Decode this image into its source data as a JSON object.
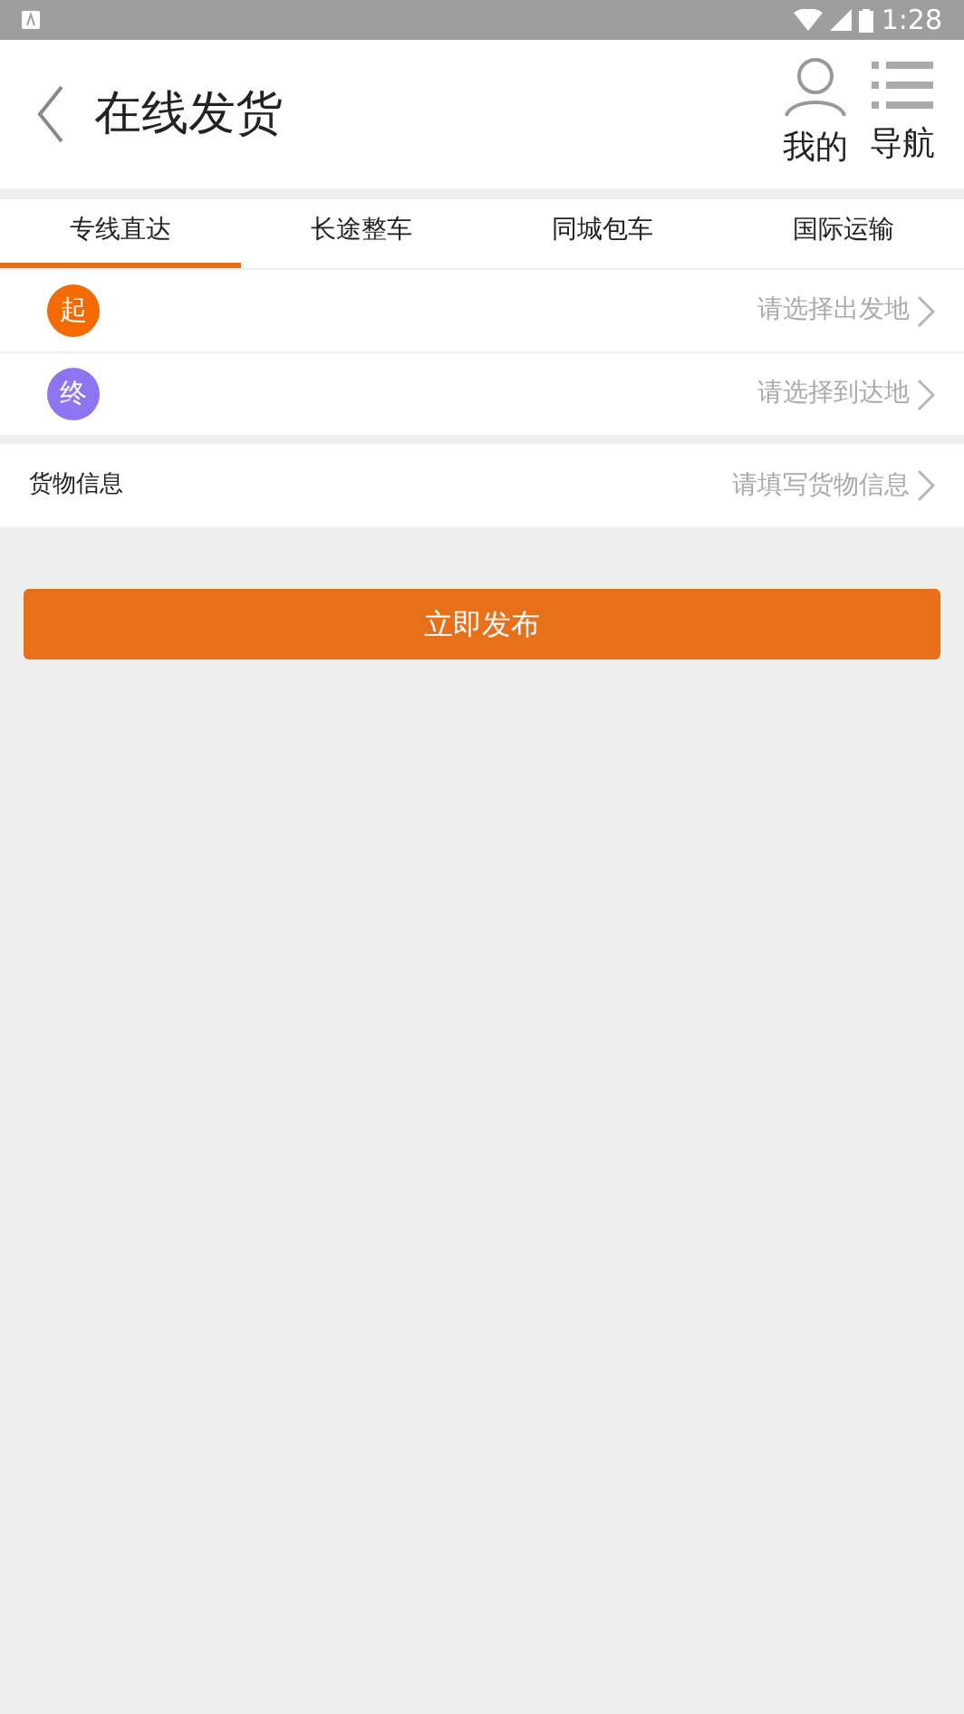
{
  "status_bar": {
    "time": "1:28"
  },
  "header": {
    "title": "在线发货",
    "actions": [
      {
        "kind": "person",
        "label": "我的"
      },
      {
        "kind": "list",
        "label": "导航"
      }
    ]
  },
  "tabs": [
    {
      "label": "专线直达",
      "selected": true
    },
    {
      "label": "长途整车",
      "selected": false
    },
    {
      "label": "同城包车",
      "selected": false
    },
    {
      "label": "国际运输",
      "selected": false
    }
  ],
  "route": [
    {
      "badge": "起",
      "color": "#f56a00",
      "placeholder": "请选择出发地"
    },
    {
      "badge": "终",
      "color": "#8e74f0",
      "placeholder": "请选择到达地"
    }
  ],
  "cargo": {
    "label": "货物信息",
    "placeholder": "请填写货物信息"
  },
  "submit": "立即发布"
}
